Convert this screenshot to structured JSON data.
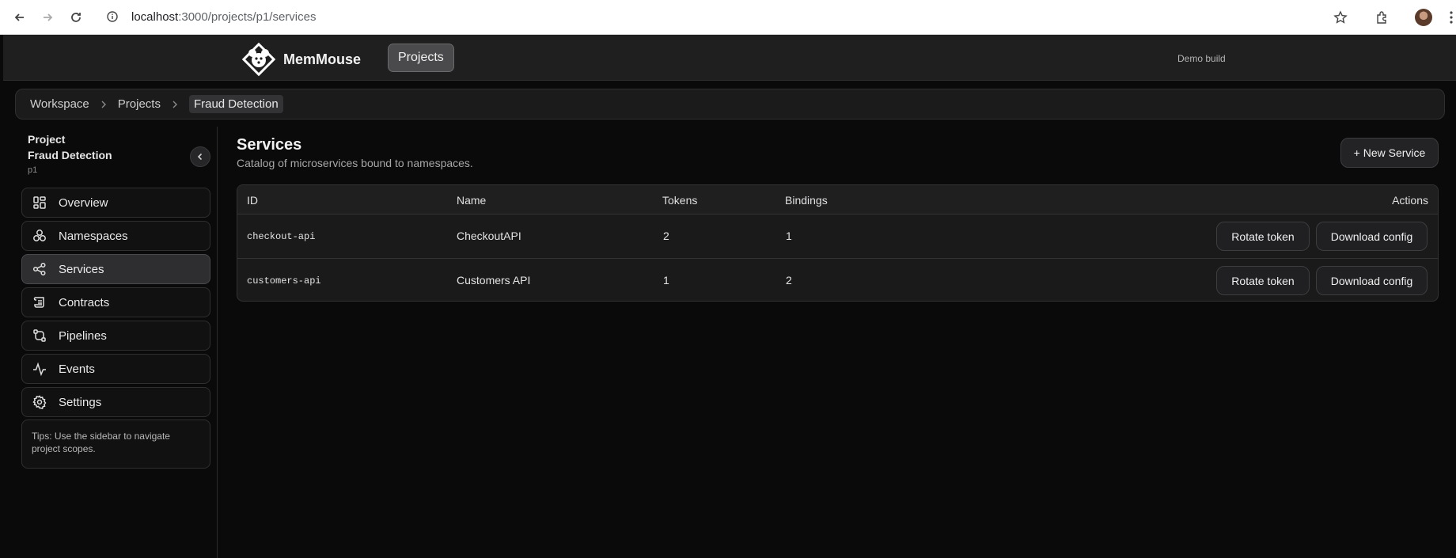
{
  "browser": {
    "url_host": "localhost",
    "url_path": ":3000/projects/p1/services"
  },
  "header": {
    "brand": "MemMouse",
    "projects_button": "Projects",
    "build_label": "Demo build"
  },
  "breadcrumb": [
    "Workspace",
    "Projects",
    "Fraud Detection"
  ],
  "sidebar": {
    "project_label": "Project",
    "project_name": "Fraud Detection",
    "project_id": "p1",
    "items": [
      {
        "label": "Overview",
        "icon": "grid-icon"
      },
      {
        "label": "Namespaces",
        "icon": "namespaces-icon"
      },
      {
        "label": "Services",
        "icon": "share-icon",
        "active": true
      },
      {
        "label": "Contracts",
        "icon": "scroll-icon"
      },
      {
        "label": "Pipelines",
        "icon": "pipeline-icon"
      },
      {
        "label": "Events",
        "icon": "activity-icon"
      },
      {
        "label": "Settings",
        "icon": "gear-icon"
      }
    ],
    "tips": "Tips: Use the sidebar to navigate project scopes."
  },
  "main": {
    "title": "Services",
    "subtitle": "Catalog of microservices bound to namespaces.",
    "new_button": "+ New Service",
    "table": {
      "columns": [
        "ID",
        "Name",
        "Tokens",
        "Bindings",
        "Actions"
      ],
      "rows": [
        {
          "id": "checkout-api",
          "name": "CheckoutAPI",
          "tokens": "2",
          "bindings": "1",
          "rotate": "Rotate token",
          "download": "Download config"
        },
        {
          "id": "customers-api",
          "name": "Customers API",
          "tokens": "1",
          "bindings": "2",
          "rotate": "Rotate token",
          "download": "Download config"
        }
      ]
    }
  }
}
